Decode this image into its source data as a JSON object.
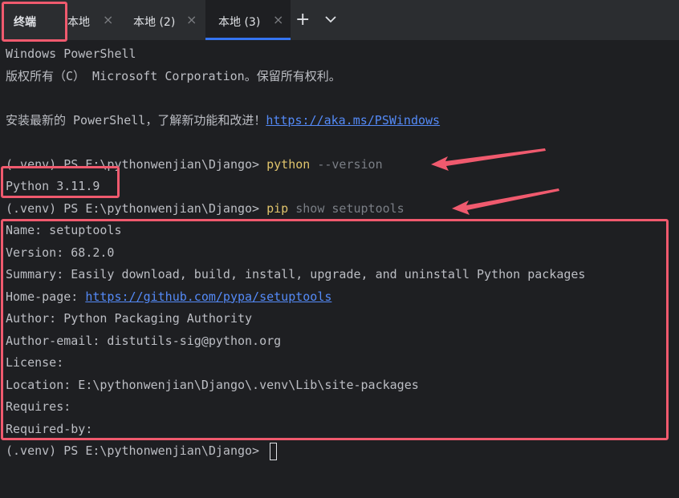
{
  "tabbar": {
    "title": "终端",
    "tabs": [
      {
        "label": "本地",
        "close": "×"
      },
      {
        "label": "本地 (2)",
        "close": "×"
      },
      {
        "label": "本地 (3)",
        "close": "×"
      }
    ],
    "new_tab": "+"
  },
  "terminal": {
    "header1": "Windows PowerShell",
    "header2": "版权所有（C） Microsoft Corporation。保留所有权利。",
    "install_prefix": "安装最新的 PowerShell，了解新功能和改进！",
    "install_link": "https://aka.ms/PSWindows",
    "prompt": "(.venv) PS E:\\pythonwenjian\\Django> ",
    "cmd1": {
      "command": "python",
      "args": " --version"
    },
    "python_version": "Python 3.11.9",
    "cmd2": {
      "command": "pip",
      "args": " show setuptools"
    },
    "pip_output": {
      "name": "Name: setuptools",
      "version": "Version: 68.2.0",
      "summary": "Summary: Easily download, build, install, upgrade, and uninstall Python packages",
      "homepage_label": "Home-page: ",
      "homepage_url": "https://github.com/pypa/setuptools",
      "author": "Author: Python Packaging Authority",
      "author_email": "Author-email: distutils-sig@python.org",
      "license": "License:",
      "location": "Location: E:\\pythonwenjian\\Django\\.venv\\Lib\\site-packages",
      "requires": "Requires:",
      "required_by": "Required-by:"
    }
  },
  "colors": {
    "highlight": "#f05a6e",
    "command": "#e0c46c",
    "link": "#548af7",
    "background": "#1e1f22"
  }
}
